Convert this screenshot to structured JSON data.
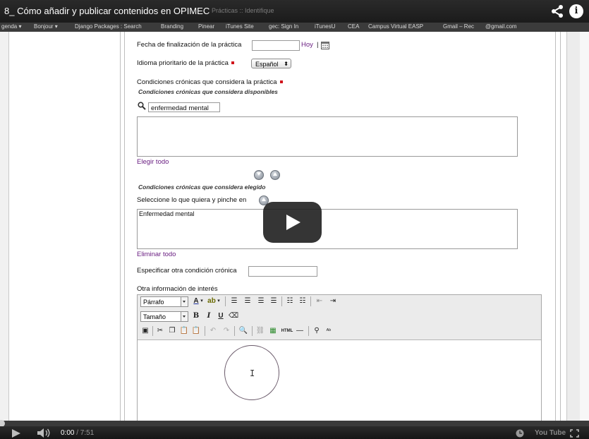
{
  "video": {
    "title": "8_ Cómo añadir y publicar contenidos en OPIMEC",
    "ghost_title": "Prácticas :: Identifique",
    "current_time": "0:00",
    "duration": "/ 7:51",
    "youtube_label": "You Tube"
  },
  "bookmarks": [
    "genda ▾",
    "Bonjour ▾",
    "Django Packages : Search",
    "Branding",
    "Pinear",
    "iTunes Site",
    "gec: Sign In",
    "iTunesU",
    "CEA",
    "Campus Virtual EASP",
    "Gmail – Rec",
    "@gmail.com"
  ],
  "form": {
    "end_date_label": "Fecha de finalización de la práctica",
    "end_date_value": "",
    "today_link": "Hoy",
    "pipe": "|",
    "language_label": "Idioma prioritario de la práctica",
    "language_value": "Español",
    "conditions_label": "Condiciones crónicas que considera la práctica",
    "available_sub": "Condiciones crónicas que considera disponibles",
    "search_value": "enfermedad mental",
    "choose_all": "Elegir todo",
    "chosen_sub": "Condiciones crónicas que considera elegido",
    "select_hint": "Seleccione lo que quiera y pinche en",
    "chosen_items": [
      "Enfermedad mental"
    ],
    "remove_all": "Eliminar todo",
    "other_condition_label": "Especificar otra condición crónica",
    "other_condition_value": "",
    "other_info_label": "Otra información de interés"
  },
  "editor": {
    "format_value": "Párrafo",
    "size_value": "Tamaño",
    "font_color_glyph": "A",
    "bold": "B",
    "italic": "I",
    "underline": "U",
    "html_label": "HTML"
  },
  "colors": {
    "link": "#6a1f82",
    "required": "#d0141b",
    "player_bar": "#1b1b1b"
  }
}
